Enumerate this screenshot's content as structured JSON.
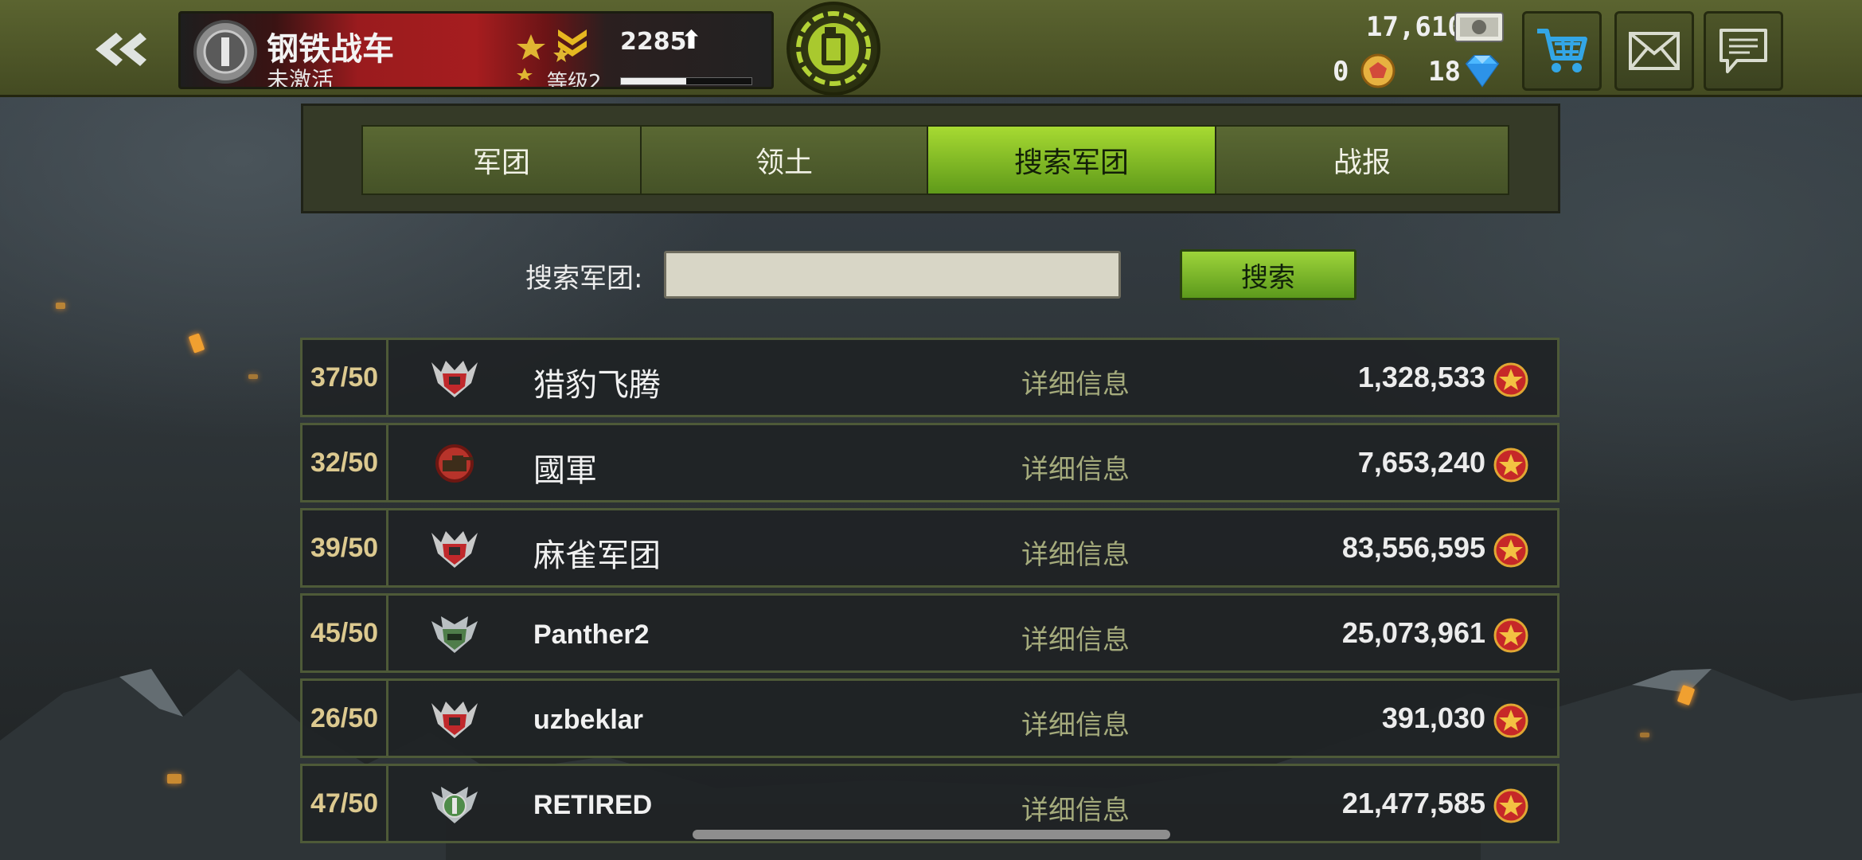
{
  "header": {
    "back_icon": "double-chevron-left-icon",
    "profile": {
      "name": "钢铁战车",
      "status": "未激活",
      "level_label": "等级2",
      "xp": "2285",
      "xp_arrow": "⬆",
      "xp_progress": 0.5
    },
    "fuel_icon": "fuel-can-icon",
    "currencies": {
      "silver": "17,610",
      "gold": "0",
      "diamonds": "18"
    },
    "buttons": {
      "shop_icon": "cart-icon",
      "mail_icon": "mail-icon",
      "chat_icon": "chat-icon"
    }
  },
  "tabs": [
    {
      "label": "军团",
      "active": false
    },
    {
      "label": "领土",
      "active": false
    },
    {
      "label": "搜索军团",
      "active": true
    },
    {
      "label": "战报",
      "active": false
    }
  ],
  "search": {
    "label": "搜索军团:",
    "value": "",
    "button_label": "搜索"
  },
  "clans": [
    {
      "members": "37/50",
      "name": "猎豹飞腾",
      "detail": "详细信息",
      "score": "1,328,533",
      "emblem": "red-wing-emblem"
    },
    {
      "members": "32/50",
      "name": "國軍",
      "detail": "详细信息",
      "score": "7,653,240",
      "emblem": "red-tank-emblem"
    },
    {
      "members": "39/50",
      "name": "麻雀军团",
      "detail": "详细信息",
      "score": "83,556,595",
      "emblem": "red-wing-emblem"
    },
    {
      "members": "45/50",
      "name": "Panther2",
      "detail": "详细信息",
      "score": "25,073,961",
      "emblem": "green-wing-emblem"
    },
    {
      "members": "26/50",
      "name": "uzbeklar",
      "detail": "详细信息",
      "score": "391,030",
      "emblem": "red-wing-emblem"
    },
    {
      "members": "47/50",
      "name": "RETIRED",
      "detail": "详细信息",
      "score": "21,477,585",
      "emblem": "green-rank-emblem"
    }
  ],
  "colors": {
    "accent_green": "#9dd43a",
    "topbar": "#505828",
    "score_star": "#c62828"
  }
}
